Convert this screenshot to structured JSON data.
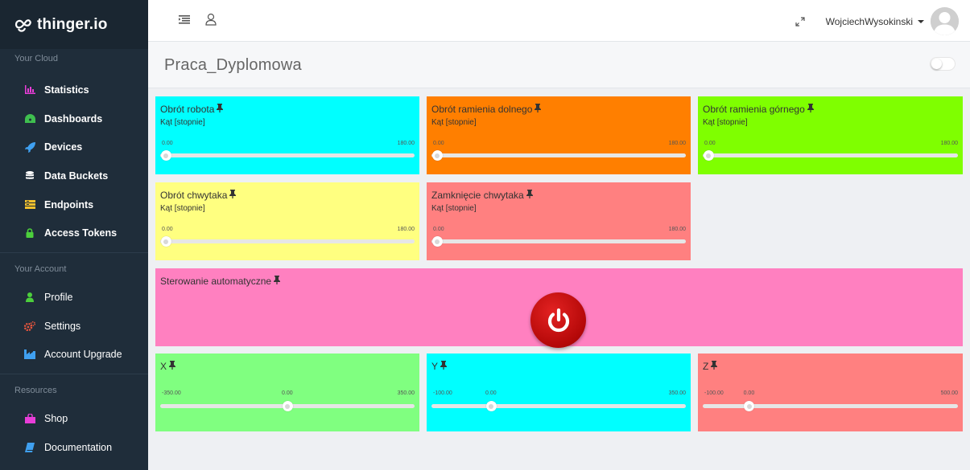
{
  "app": {
    "logo_text": "thinger.io"
  },
  "sidebar": {
    "sections": [
      {
        "label": "Your Cloud"
      },
      {
        "label": "Your Account"
      },
      {
        "label": "Resources"
      }
    ],
    "cloud_items": [
      {
        "label": "Statistics",
        "icon": "chart-icon",
        "color": "#e83dd8"
      },
      {
        "label": "Dashboards",
        "icon": "dashboard-icon",
        "color": "#3fbf4f"
      },
      {
        "label": "Devices",
        "icon": "rocket-icon",
        "color": "#3fa0f0"
      },
      {
        "label": "Data Buckets",
        "icon": "database-icon",
        "color": "#ffffff"
      },
      {
        "label": "Endpoints",
        "icon": "endpoints-icon",
        "color": "#f2c12e"
      },
      {
        "label": "Access Tokens",
        "icon": "lock-icon",
        "color": "#4ccf3c"
      }
    ],
    "account_items": [
      {
        "label": "Profile",
        "icon": "user-icon",
        "color": "#4ccf3c"
      },
      {
        "label": "Settings",
        "icon": "gears-icon",
        "color": "#e8563e"
      },
      {
        "label": "Account Upgrade",
        "icon": "industry-icon",
        "color": "#3fa0f0"
      }
    ],
    "resource_items": [
      {
        "label": "Shop",
        "icon": "shopping-bag-icon",
        "color": "#e83dd8"
      },
      {
        "label": "Documentation",
        "icon": "book-icon",
        "color": "#3fa0f0"
      }
    ]
  },
  "topbar": {
    "username": "WojciechWysokinski"
  },
  "page": {
    "title": "Praca_Dyplomowa"
  },
  "widgets": [
    {
      "title": "Obrót robota",
      "subtitle": "Kąt [stopnie]",
      "min": "0.00",
      "max": "180.00",
      "value": "",
      "level": 0,
      "color": "#00ffff"
    },
    {
      "title": "Obrót ramienia dolnego",
      "subtitle": "Kąt [stopnie]",
      "min": "0.00",
      "max": "180.00",
      "value": "",
      "level": 0,
      "color": "#ff7f00"
    },
    {
      "title": "Obrót ramienia górnego",
      "subtitle": "Kąt [stopnie]",
      "min": "0.00",
      "max": "180.00",
      "value": "",
      "level": 0,
      "color": "#7fff00"
    },
    {
      "title": "Obrót chwytaka",
      "subtitle": "Kąt [stopnie]",
      "min": "0.00",
      "max": "180.00",
      "value": "",
      "level": 0,
      "color": "#ffff80"
    },
    {
      "title": "Zamknięcie chwytaka",
      "subtitle": "Kąt [stopnie]",
      "min": "0.00",
      "max": "180.00",
      "value": "",
      "level": 0,
      "color": "#ff8080"
    },
    {
      "title": "Sterowanie automatyczne",
      "color": "#ff80c0",
      "state": "off"
    },
    {
      "title": "X",
      "subtitle": "",
      "min": "-350.00",
      "max": "350.00",
      "value": "0.00",
      "level": 0.5,
      "color": "#80ff80"
    },
    {
      "title": "Y",
      "subtitle": "",
      "min": "-100.00",
      "max": "350.00",
      "value": "0.00",
      "level": 0.222,
      "color": "#00ffff"
    },
    {
      "title": "Z",
      "subtitle": "",
      "min": "-100.00",
      "max": "500.00",
      "value": "0.00",
      "level": 0.167,
      "color": "#ff8080"
    }
  ]
}
